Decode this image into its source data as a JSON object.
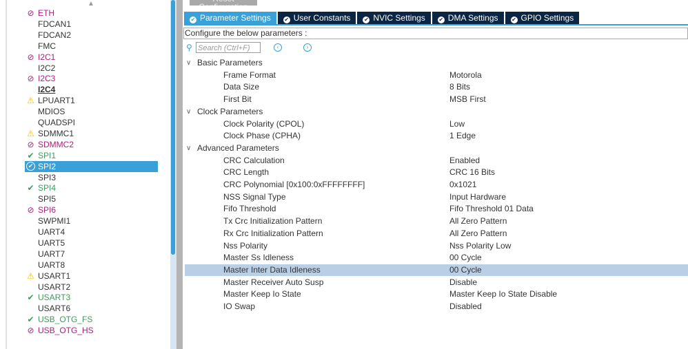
{
  "sidebar": {
    "items": [
      {
        "label": "ETH",
        "status": "disabled",
        "icon": "ban-icon"
      },
      {
        "label": "FDCAN1",
        "status": "none"
      },
      {
        "label": "FDCAN2",
        "status": "none"
      },
      {
        "label": "FMC",
        "status": "none"
      },
      {
        "label": "I2C1",
        "status": "disabled",
        "icon": "ban-icon"
      },
      {
        "label": "I2C2",
        "status": "none"
      },
      {
        "label": "I2C3",
        "status": "disabled",
        "icon": "ban-icon"
      },
      {
        "label": "I2C4",
        "status": "under"
      },
      {
        "label": "LPUART1",
        "status": "warn",
        "icon": "warning-icon"
      },
      {
        "label": "MDIOS",
        "status": "none"
      },
      {
        "label": "QUADSPI",
        "status": "none"
      },
      {
        "label": "SDMMC1",
        "status": "warn",
        "icon": "warning-icon"
      },
      {
        "label": "SDMMC2",
        "status": "disabled",
        "icon": "ban-icon"
      },
      {
        "label": "SPI1",
        "status": "ok",
        "icon": "check-icon"
      },
      {
        "label": "SPI2",
        "status": "sel",
        "icon": "check-circle-icon"
      },
      {
        "label": "SPI3",
        "status": "none"
      },
      {
        "label": "SPI4",
        "status": "ok",
        "icon": "check-icon"
      },
      {
        "label": "SPI5",
        "status": "none"
      },
      {
        "label": "SPI6",
        "status": "disabled",
        "icon": "ban-icon"
      },
      {
        "label": "SWPMI1",
        "status": "none"
      },
      {
        "label": "UART4",
        "status": "none"
      },
      {
        "label": "UART5",
        "status": "none"
      },
      {
        "label": "UART7",
        "status": "none"
      },
      {
        "label": "UART8",
        "status": "none"
      },
      {
        "label": "USART1",
        "status": "warn",
        "icon": "warning-icon"
      },
      {
        "label": "USART2",
        "status": "none"
      },
      {
        "label": "USART3",
        "status": "ok",
        "icon": "check-icon"
      },
      {
        "label": "USART6",
        "status": "none"
      },
      {
        "label": "USB_OTG_FS",
        "status": "ok",
        "icon": "check-icon"
      },
      {
        "label": "USB_OTG_HS",
        "status": "disabled",
        "icon": "ban-icon"
      }
    ]
  },
  "toolbar": {
    "reset_label": "Reset Configuration"
  },
  "tabs": [
    "Parameter Settings",
    "User Constants",
    "NVIC Settings",
    "DMA Settings",
    "GPIO Settings"
  ],
  "configure_label": "Configure the below parameters :",
  "search": {
    "placeholder": "Search (Ctrl+F)"
  },
  "groups": [
    {
      "title": "Basic Parameters",
      "params": [
        [
          "Frame Format",
          "Motorola"
        ],
        [
          "Data Size",
          "8 Bits"
        ],
        [
          "First Bit",
          "MSB First"
        ]
      ]
    },
    {
      "title": "Clock Parameters",
      "params": [
        [
          "Clock Polarity (CPOL)",
          "Low"
        ],
        [
          "Clock Phase (CPHA)",
          "1 Edge"
        ]
      ]
    },
    {
      "title": "Advanced Parameters",
      "params": [
        [
          "CRC Calculation",
          "Enabled"
        ],
        [
          "CRC Length",
          "CRC 16 Bits"
        ],
        [
          "CRC Polynomial [0x100:0xFFFFFFFF]",
          "0x1021"
        ],
        [
          "NSS Signal Type",
          "Input Hardware"
        ],
        [
          "Fifo Threshold",
          "Fifo Threshold 01 Data"
        ],
        [
          "Tx Crc Initialization Pattern",
          "All Zero Pattern"
        ],
        [
          "Rx Crc Initialization Pattern",
          "All Zero Pattern"
        ],
        [
          "Nss Polarity",
          "Nss Polarity Low"
        ],
        [
          "Master Ss Idleness",
          "00 Cycle"
        ],
        [
          "Master Inter Data Idleness",
          "00 Cycle"
        ],
        [
          "Master Receiver Auto Susp",
          "Disable"
        ],
        [
          "Master Keep Io State",
          "Master Keep Io State Disable"
        ],
        [
          "IO Swap",
          "Disabled"
        ]
      ]
    }
  ],
  "selected_param": "Master Inter Data Idleness"
}
